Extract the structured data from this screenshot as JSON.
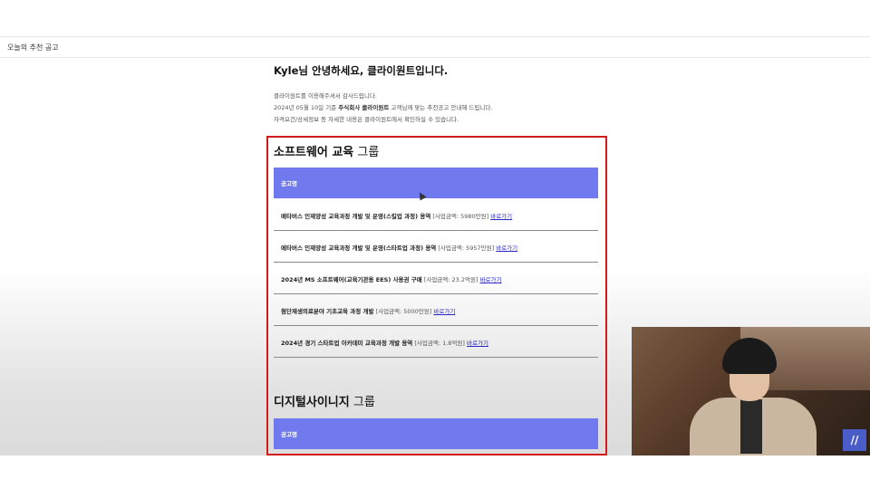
{
  "tab": {
    "label": "오늘의 추천 공고"
  },
  "email": {
    "greeting": "Kyle님 안녕하세요, 클라이원트입니다.",
    "intro_line1": "클라이원트를 이용해주셔서 감사드립니다.",
    "intro_line2_prefix": "2024년 05월 10일 기준 ",
    "intro_line2_bold": "주식회사 클라이원트",
    "intro_line2_suffix": " 고객님께 맞는 추천공고 안내해 드립니다.",
    "intro_line3": "자격요건/상세정보 등 자세한 내용은 클라이원트에서 확인하실 수 있습니다."
  },
  "groups": [
    {
      "title_main": "소프트웨어 교육",
      "title_sub": " 그룹",
      "header": "공고명",
      "rows": [
        {
          "name": "메타버스 인재양성 교육과정 개발 및 운영(스킬업 과정) 용역",
          "amount": " [사업금액: 5980만원]",
          "link": "바로가기"
        },
        {
          "name": "메타버스 인재양성 교육과정 개발 및 운영(스타트업 과정) 용역",
          "amount": " [사업금액: 5957만원]",
          "link": "바로가기"
        },
        {
          "name": "2024년 MS 소프트웨어(교육기관용 EES) 사용권 구매",
          "amount": " [사업금액: 23.2억원]",
          "link": "바로가기"
        },
        {
          "name": "첨단재생의료분야 기초교육 과정 개발",
          "amount": " [사업금액: 5000만원]",
          "link": "바로가기"
        },
        {
          "name": "2024년 경기 스타트업 아카데미 교육과정 개발 용역",
          "amount": " [사업금액: 1.8억원]",
          "link": "바로가기"
        }
      ]
    },
    {
      "title_main": "디지털사이니지",
      "title_sub": " 그룹",
      "header": "공고명"
    }
  ],
  "overlay": {
    "logo_text": "//"
  },
  "colors": {
    "table_header": "#7079ee",
    "highlight_frame": "#d21c1c",
    "link": "#2727c8"
  }
}
